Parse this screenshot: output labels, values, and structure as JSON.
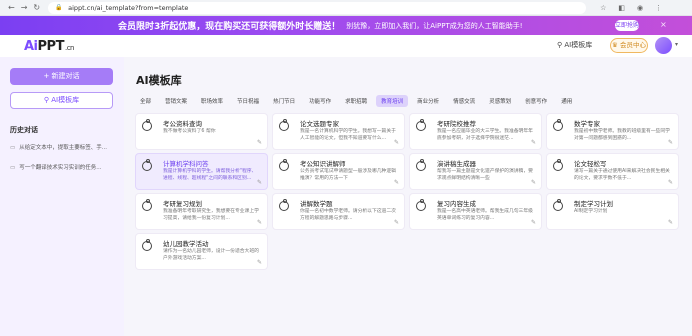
{
  "browser": {
    "url": "aippt.cn/ai_template?from=template",
    "nav": [
      "←",
      "→",
      "↻"
    ]
  },
  "banner": {
    "headline": "会员限时3折起优惠，现在购买还可获得额外时长赠送！",
    "sub": "别犹豫，立即加入我们，让AiPPT成为您的人工智能助手!",
    "button": "立即抢购",
    "close": "×"
  },
  "topbar": {
    "logo_main": "Ai",
    "logo_rest": "PPT",
    "logo_suffix": ".cn",
    "lib": "AI模板库",
    "vip": "会员中心",
    "caret": "▾"
  },
  "sidebar": {
    "new_chat": "+ 新建对话",
    "templates": "AI模板库",
    "history_title": "历史对话",
    "history": [
      {
        "icon": "▭",
        "text": "从给定文本中，提取主要标签、手..."
      },
      {
        "icon": "▭",
        "text": "写一个翻译技术实习实训的任务..."
      }
    ]
  },
  "main": {
    "title": "AI模板库",
    "tabs": [
      "全部",
      "营销文案",
      "职场效率",
      "节日祝福",
      "热门节日",
      "功能写作",
      "求职招聘",
      "教育培训",
      "商业分析",
      "情感交流",
      "灵感策划",
      "创意写作",
      "通用"
    ],
    "active_tab": 7,
    "cards": [
      {
        "title": "考公资料查询",
        "desc": "我不做考公资料了6 帮你"
      },
      {
        "title": "论文选题专家",
        "desc": "我是一名计算机科学的学生。我想写一篇关于人工智能的论文，但我不知道要写什么..."
      },
      {
        "title": "考研院校推荐",
        "desc": "我是一名应届毕业的大三学生。我准备明年年底参加考研，对于选择学院很迷茫..."
      },
      {
        "title": "数学专家",
        "desc": "我是初中数学老师。我教的班级里有一些同学对第一问题都感到困惑的..."
      },
      {
        "title": "计算机学科问答",
        "desc": "我是计算机学科的学生。请帮我分析\"程序、进程、线程、超线程\"之间的联系和区别...",
        "active": true
      },
      {
        "title": "考公知识讲解师",
        "desc": "公务员考试笔试申请题型一般涉及哪几种逻辑推演？常用的方法一下"
      },
      {
        "title": "演讲稿生成器",
        "desc": "帮我写一篇主题是文化遗产保护的演讲稿，要求观点鲜明结构清晰一些"
      },
      {
        "title": "论文轻松写",
        "desc": "请写一篇关于通过使用AI来解决社会民生相关的论文，要求字数不低于..."
      },
      {
        "title": "考研复习规划",
        "desc": "我准备明年考取研究生，我想要在专业课上学习提高，请给我一份复习计划..."
      },
      {
        "title": "讲解数学题",
        "desc": "你是一名初中数学老师。请分析以下这道二次方程的解题思路与步骤..."
      },
      {
        "title": "复习内容生成",
        "desc": "我是一名高中英语老师。帮我生成几句三年级英语单词练习的复习内容..."
      },
      {
        "title": "制定学习计划",
        "desc": "AI制定学习计划"
      },
      {
        "title": "幼儿园教学活动",
        "desc": "请作为一名幼儿园老师，设计一份适合大班的户外游戏活动方案..."
      }
    ],
    "edit_icon": "✎"
  }
}
